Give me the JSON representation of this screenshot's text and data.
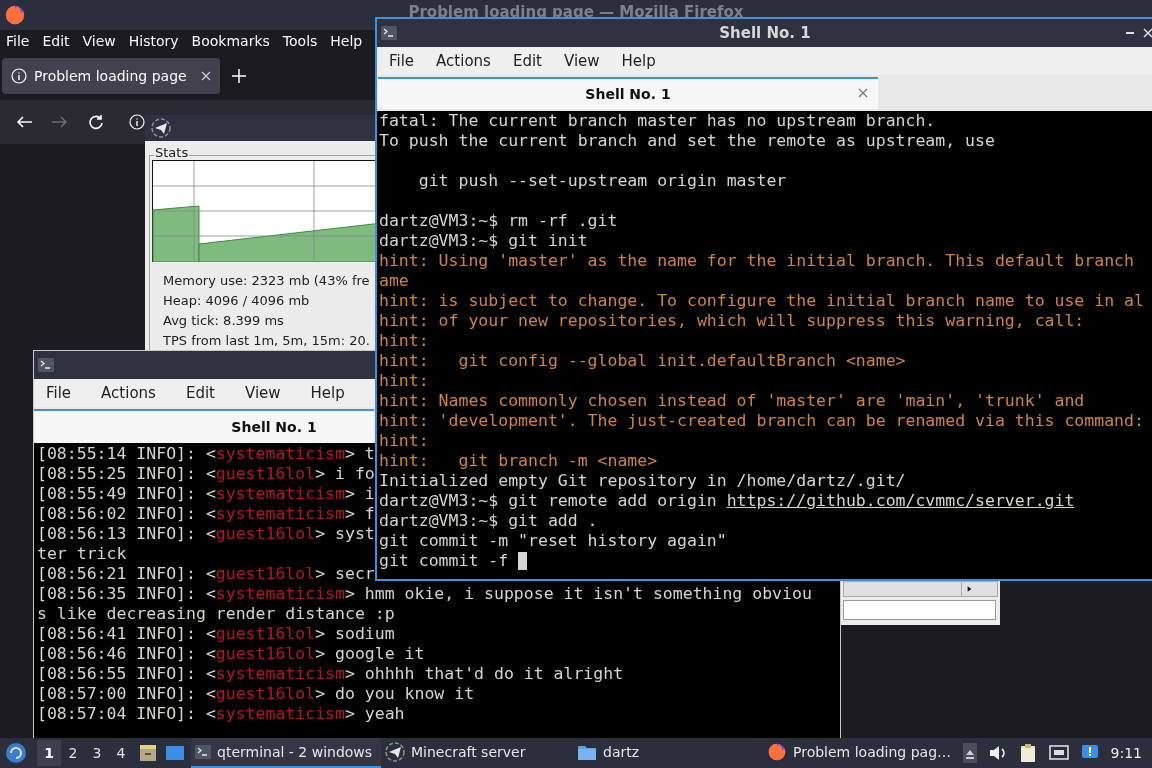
{
  "firefox": {
    "title": "Problem loading page — Mozilla Firefox",
    "menu": [
      "File",
      "Edit",
      "View",
      "History",
      "Bookmarks",
      "Tools",
      "Help"
    ],
    "tabs": [
      {
        "label": "Problem loading page",
        "selected": true
      }
    ],
    "nav_buttons": [
      {
        "kind": "back",
        "disabled": false
      },
      {
        "kind": "forward",
        "disabled": true
      },
      {
        "kind": "reload",
        "disabled": false
      }
    ]
  },
  "server_window": {
    "group_title": "Stats",
    "stats": [
      "Memory use: 2323 mb (43% fre",
      "Heap: 4096 / 4096 mb",
      "Avg tick: 8.399 ms",
      "TPS from last 1m, 5m, 15m: 20."
    ]
  },
  "chat_terminal": {
    "menu": [
      "File",
      "Actions",
      "Edit",
      "View",
      "Help"
    ],
    "tab": "Shell No. 1",
    "lines": [
      {
        "kind": "chat",
        "prefix": "[08:55:14 INFO]: <",
        "user": "systematicism",
        "rest": "> t"
      },
      {
        "kind": "chat",
        "prefix": "[08:55:25 INFO]: <",
        "user": "guest16lol",
        "rest": "> i fo"
      },
      {
        "kind": "chat",
        "prefix": "[08:55:49 INFO]: <",
        "user": "systematicism",
        "rest": "> i"
      },
      {
        "kind": "chat",
        "prefix": "[08:56:02 INFO]: <",
        "user": "systematicism",
        "rest": "> f"
      },
      {
        "kind": "chat",
        "prefix": "[08:56:13 INFO]: <",
        "user": "guest16lol",
        "rest": "> syst"
      },
      {
        "kind": "wrap",
        "text": "ter trick"
      },
      {
        "kind": "chat",
        "prefix": "[08:56:21 INFO]: <",
        "user": "guest16lol",
        "rest": "> secr"
      },
      {
        "kind": "chat",
        "prefix": "[08:56:35 INFO]: <",
        "user": "systematicism",
        "rest": "> hmm okie, i suppose it isn't something obviou"
      },
      {
        "kind": "wrap",
        "text": "s like decreasing render distance :p"
      },
      {
        "kind": "chat",
        "prefix": "[08:56:41 INFO]: <",
        "user": "guest16lol",
        "rest": "> sodium"
      },
      {
        "kind": "chat",
        "prefix": "[08:56:46 INFO]: <",
        "user": "guest16lol",
        "rest": "> google it"
      },
      {
        "kind": "chat",
        "prefix": "[08:56:55 INFO]: <",
        "user": "systematicism",
        "rest": "> ohhhh that'd do it alright"
      },
      {
        "kind": "chat",
        "prefix": "[08:57:00 INFO]: <",
        "user": "guest16lol",
        "rest": "> do you know it"
      },
      {
        "kind": "chat",
        "prefix": "[08:57:04 INFO]: <",
        "user": "systematicism",
        "rest": "> yeah"
      }
    ]
  },
  "git_terminal": {
    "title": "Shell No. 1",
    "menu": [
      "File",
      "Actions",
      "Edit",
      "View",
      "Help"
    ],
    "tab": "Shell No. 1",
    "lines": [
      {
        "kind": "plain",
        "text": "fatal: The current branch master has no upstream branch."
      },
      {
        "kind": "plain",
        "text": "To push the current branch and set the remote as upstream, use"
      },
      {
        "kind": "blank"
      },
      {
        "kind": "plain",
        "text": "    git push --set-upstream origin master"
      },
      {
        "kind": "blank"
      },
      {
        "kind": "plain",
        "text": "dartz@VM3:~$ rm -rf .git"
      },
      {
        "kind": "plain",
        "text": "dartz@VM3:~$ git init"
      },
      {
        "kind": "hint",
        "text": "hint: Using 'master' as the name for the initial branch. This default branch"
      },
      {
        "kind": "hint",
        "text": "ame"
      },
      {
        "kind": "hint",
        "text": "hint: is subject to change. To configure the initial branch name to use in al"
      },
      {
        "kind": "hint",
        "text": "hint: of your new repositories, which will suppress this warning, call:"
      },
      {
        "kind": "hint",
        "text": "hint:"
      },
      {
        "kind": "hint",
        "text": "hint:   git config --global init.defaultBranch <name>"
      },
      {
        "kind": "hint",
        "text": "hint:"
      },
      {
        "kind": "hint",
        "text": "hint: Names commonly chosen instead of 'master' are 'main', 'trunk' and"
      },
      {
        "kind": "hint",
        "text": "hint: 'development'. The just-created branch can be renamed via this command:"
      },
      {
        "kind": "hint",
        "text": "hint:"
      },
      {
        "kind": "hint",
        "text": "hint:   git branch -m <name>"
      },
      {
        "kind": "plain",
        "text": "Initialized empty Git repository in /home/dartz/.git/"
      },
      {
        "kind": "plain",
        "text": "dartz@VM3:~$ git remote add origin ",
        "link": "https://github.com/cvmmc/server.git"
      },
      {
        "kind": "plain",
        "text": "dartz@VM3:~$ git add ."
      },
      {
        "kind": "plain",
        "text": "git commit -m \"reset history again\""
      },
      {
        "kind": "plain",
        "text": "git commit -f ",
        "cursor": true
      }
    ]
  },
  "taskbar": {
    "workspaces": [
      {
        "label": "1",
        "selected": true
      },
      {
        "label": "2",
        "selected": false
      },
      {
        "label": "3",
        "selected": false
      },
      {
        "label": "4",
        "selected": false
      }
    ],
    "tasks": [
      {
        "kind": "terminal",
        "label": "qterminal - 2 windows",
        "selected": true
      },
      {
        "kind": "server",
        "label": "Minecraft server",
        "selected": false
      },
      {
        "kind": "folder",
        "label": "dartz",
        "selected": false
      },
      {
        "kind": "browser",
        "label": "Problem loading pag…",
        "selected": false
      }
    ],
    "clock": "9:11"
  }
}
